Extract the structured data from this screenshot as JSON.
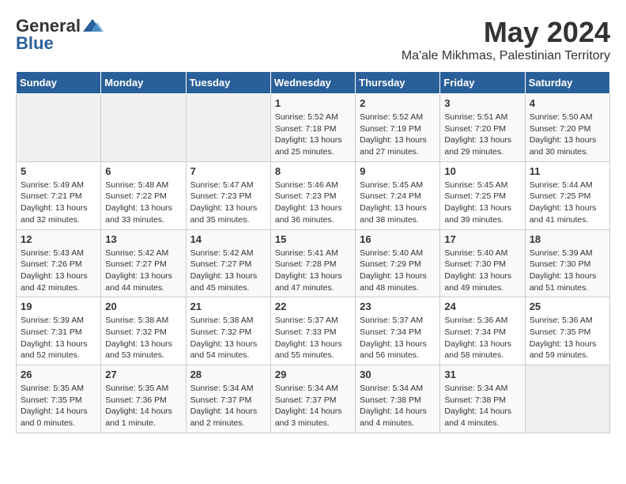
{
  "logo": {
    "general": "General",
    "blue": "Blue"
  },
  "title": "May 2024",
  "location": "Ma'ale Mikhmas, Palestinian Territory",
  "days_of_week": [
    "Sunday",
    "Monday",
    "Tuesday",
    "Wednesday",
    "Thursday",
    "Friday",
    "Saturday"
  ],
  "weeks": [
    [
      {
        "day": "",
        "empty": true
      },
      {
        "day": "",
        "empty": true
      },
      {
        "day": "",
        "empty": true
      },
      {
        "day": "1",
        "sunrise": "5:52 AM",
        "sunset": "7:18 PM",
        "daylight": "13 hours and 25 minutes."
      },
      {
        "day": "2",
        "sunrise": "5:52 AM",
        "sunset": "7:19 PM",
        "daylight": "13 hours and 27 minutes."
      },
      {
        "day": "3",
        "sunrise": "5:51 AM",
        "sunset": "7:20 PM",
        "daylight": "13 hours and 29 minutes."
      },
      {
        "day": "4",
        "sunrise": "5:50 AM",
        "sunset": "7:20 PM",
        "daylight": "13 hours and 30 minutes."
      }
    ],
    [
      {
        "day": "5",
        "sunrise": "5:49 AM",
        "sunset": "7:21 PM",
        "daylight": "13 hours and 32 minutes."
      },
      {
        "day": "6",
        "sunrise": "5:48 AM",
        "sunset": "7:22 PM",
        "daylight": "13 hours and 33 minutes."
      },
      {
        "day": "7",
        "sunrise": "5:47 AM",
        "sunset": "7:23 PM",
        "daylight": "13 hours and 35 minutes."
      },
      {
        "day": "8",
        "sunrise": "5:46 AM",
        "sunset": "7:23 PM",
        "daylight": "13 hours and 36 minutes."
      },
      {
        "day": "9",
        "sunrise": "5:45 AM",
        "sunset": "7:24 PM",
        "daylight": "13 hours and 38 minutes."
      },
      {
        "day": "10",
        "sunrise": "5:45 AM",
        "sunset": "7:25 PM",
        "daylight": "13 hours and 39 minutes."
      },
      {
        "day": "11",
        "sunrise": "5:44 AM",
        "sunset": "7:25 PM",
        "daylight": "13 hours and 41 minutes."
      }
    ],
    [
      {
        "day": "12",
        "sunrise": "5:43 AM",
        "sunset": "7:26 PM",
        "daylight": "13 hours and 42 minutes."
      },
      {
        "day": "13",
        "sunrise": "5:42 AM",
        "sunset": "7:27 PM",
        "daylight": "13 hours and 44 minutes."
      },
      {
        "day": "14",
        "sunrise": "5:42 AM",
        "sunset": "7:27 PM",
        "daylight": "13 hours and 45 minutes."
      },
      {
        "day": "15",
        "sunrise": "5:41 AM",
        "sunset": "7:28 PM",
        "daylight": "13 hours and 47 minutes."
      },
      {
        "day": "16",
        "sunrise": "5:40 AM",
        "sunset": "7:29 PM",
        "daylight": "13 hours and 48 minutes."
      },
      {
        "day": "17",
        "sunrise": "5:40 AM",
        "sunset": "7:30 PM",
        "daylight": "13 hours and 49 minutes."
      },
      {
        "day": "18",
        "sunrise": "5:39 AM",
        "sunset": "7:30 PM",
        "daylight": "13 hours and 51 minutes."
      }
    ],
    [
      {
        "day": "19",
        "sunrise": "5:39 AM",
        "sunset": "7:31 PM",
        "daylight": "13 hours and 52 minutes."
      },
      {
        "day": "20",
        "sunrise": "5:38 AM",
        "sunset": "7:32 PM",
        "daylight": "13 hours and 53 minutes."
      },
      {
        "day": "21",
        "sunrise": "5:38 AM",
        "sunset": "7:32 PM",
        "daylight": "13 hours and 54 minutes."
      },
      {
        "day": "22",
        "sunrise": "5:37 AM",
        "sunset": "7:33 PM",
        "daylight": "13 hours and 55 minutes."
      },
      {
        "day": "23",
        "sunrise": "5:37 AM",
        "sunset": "7:34 PM",
        "daylight": "13 hours and 56 minutes."
      },
      {
        "day": "24",
        "sunrise": "5:36 AM",
        "sunset": "7:34 PM",
        "daylight": "13 hours and 58 minutes."
      },
      {
        "day": "25",
        "sunrise": "5:36 AM",
        "sunset": "7:35 PM",
        "daylight": "13 hours and 59 minutes."
      }
    ],
    [
      {
        "day": "26",
        "sunrise": "5:35 AM",
        "sunset": "7:35 PM",
        "daylight": "14 hours and 0 minutes."
      },
      {
        "day": "27",
        "sunrise": "5:35 AM",
        "sunset": "7:36 PM",
        "daylight": "14 hours and 1 minute."
      },
      {
        "day": "28",
        "sunrise": "5:34 AM",
        "sunset": "7:37 PM",
        "daylight": "14 hours and 2 minutes."
      },
      {
        "day": "29",
        "sunrise": "5:34 AM",
        "sunset": "7:37 PM",
        "daylight": "14 hours and 3 minutes."
      },
      {
        "day": "30",
        "sunrise": "5:34 AM",
        "sunset": "7:38 PM",
        "daylight": "14 hours and 4 minutes."
      },
      {
        "day": "31",
        "sunrise": "5:34 AM",
        "sunset": "7:38 PM",
        "daylight": "14 hours and 4 minutes."
      },
      {
        "day": "",
        "empty": true
      }
    ]
  ],
  "labels": {
    "sunrise": "Sunrise:",
    "sunset": "Sunset:",
    "daylight": "Daylight:"
  }
}
